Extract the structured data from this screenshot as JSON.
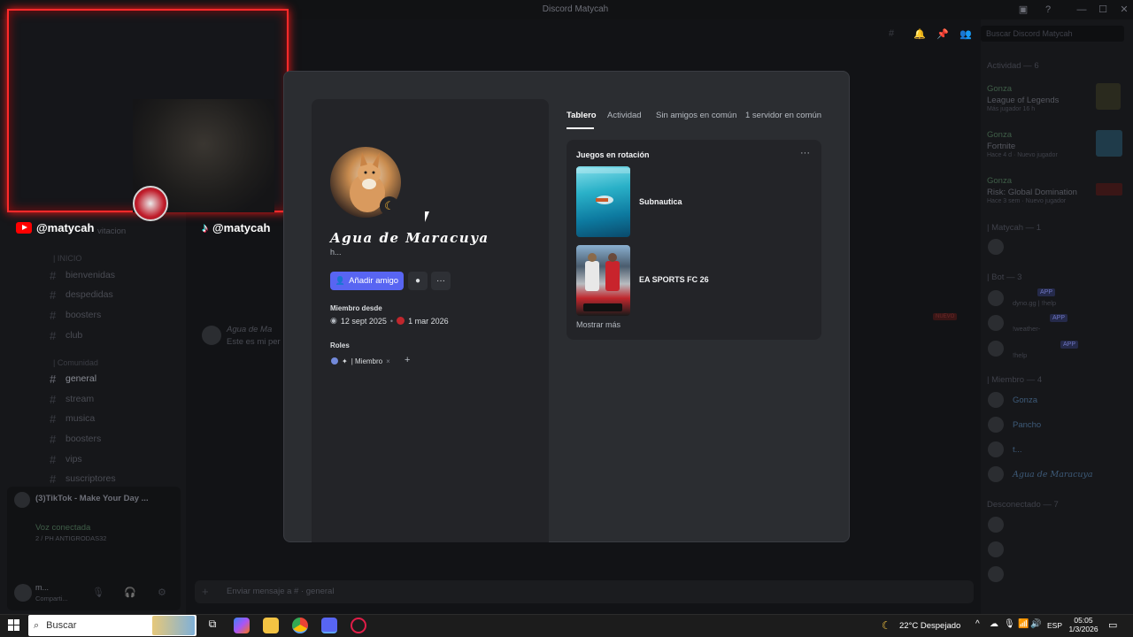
{
  "window": {
    "title": "Discord Matycah"
  },
  "sidebar": {
    "categories": [
      "| INICIO",
      "| Comunidad"
    ],
    "channels_top": [
      {
        "label": "bienvenidas"
      },
      {
        "label": "despedidas"
      },
      {
        "label": "boosters"
      },
      {
        "label": "club"
      }
    ],
    "channels_community": [
      {
        "label": "general",
        "active": true
      },
      {
        "label": "stream"
      },
      {
        "label": "musica"
      },
      {
        "label": "boosters"
      },
      {
        "label": "vips"
      },
      {
        "label": "suscriptores"
      }
    ],
    "voice_activity": "(3)TikTok - Make Your Day ...",
    "voice_status": "Voz conectada",
    "voice_channel": "2 / PH ANTIGRODAS32",
    "user_name": "m...",
    "user_status": "Comparti..."
  },
  "header": {
    "search_placeholder": "Buscar Discord Matycah"
  },
  "overlay": {
    "youtube_handle": "@matycah",
    "tiktok_handle": "@matycah"
  },
  "chat": {
    "author": "Agua de Ma",
    "message": "Este es mi per",
    "input_placeholder": "Enviar mensaje a # · general",
    "new_badge": "NUEVO",
    "bg_text": "vitacion"
  },
  "members": {
    "activity_header": "Actividad — 6",
    "activities": [
      {
        "user": "Gonza",
        "game": "League of Legends",
        "detail": "Más jugador 16 h"
      },
      {
        "user": "Gonza",
        "game": "Fortnite",
        "detail": "Hace 4 d · Nuevo jugador"
      },
      {
        "user": "Gonza",
        "game": "Risk: Global Domination",
        "detail": "Hace 3 sem · Nuevo jugador"
      }
    ],
    "group_matycah": "| Matycah — 1",
    "group_bot": "| Bot — 3",
    "bots": [
      "dyno.gg | !help",
      "!weather-",
      "!help"
    ],
    "app_badge": "APP",
    "group_miembro": "| Miembro — 4",
    "miembros": [
      "Gonza",
      "Pancho",
      "t...",
      "Agua de Maracuya"
    ],
    "offline_header": "Desconectado — 7"
  },
  "profile": {
    "display_name": "Agua de Maracuya",
    "pronoun": "h...",
    "add_friend_label": "Añadir amigo",
    "member_since_label": "Miembro desde",
    "discord_date": "12 sept 2025",
    "server_date": "1 mar 2026",
    "date_separator": "•",
    "roles_label": "Roles",
    "role_name": "| Miembro",
    "role_remove": "×",
    "role_add": "+"
  },
  "tabs": [
    {
      "label": "Tablero",
      "active": true
    },
    {
      "label": "Actividad"
    },
    {
      "label": "Sin amigos en común"
    },
    {
      "label": "1 servidor en común"
    }
  ],
  "games": {
    "title": "Juegos en rotación",
    "items": [
      {
        "name": "Subnautica"
      },
      {
        "name": "EA SPORTS FC 26"
      }
    ],
    "show_more": "Mostrar más"
  },
  "taskbar": {
    "search_label": "Buscar",
    "weather": "22°C  Despejado",
    "lang": "ESP",
    "time": "05:05",
    "date": "1/3/2026"
  }
}
